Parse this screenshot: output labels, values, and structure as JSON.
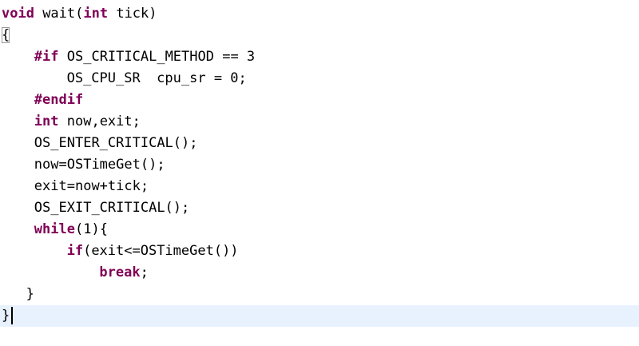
{
  "editor": {
    "colors": {
      "keyword": "#7f0055",
      "text": "#000000",
      "current_line": "#e8f2fe",
      "background": "#ffffff"
    },
    "lines": [
      {
        "indent": 0,
        "tokens": [
          {
            "t": "void",
            "k": "kw"
          },
          {
            "t": " wait(",
            "k": "plain"
          },
          {
            "t": "int",
            "k": "kw"
          },
          {
            "t": " tick)",
            "k": "plain"
          }
        ]
      },
      {
        "indent": 0,
        "tokens": [
          {
            "t": "{",
            "k": "plain",
            "hl": true
          }
        ]
      },
      {
        "indent": 4,
        "tokens": [
          {
            "t": "#if",
            "k": "kw"
          },
          {
            "t": " OS_CRITICAL_METHOD == 3",
            "k": "plain"
          }
        ]
      },
      {
        "indent": 8,
        "tokens": [
          {
            "t": "OS_CPU_SR  cpu_sr = 0;",
            "k": "plain"
          }
        ]
      },
      {
        "indent": 4,
        "tokens": [
          {
            "t": "#endif",
            "k": "kw"
          }
        ]
      },
      {
        "indent": 4,
        "tokens": [
          {
            "t": "int",
            "k": "kw"
          },
          {
            "t": " now,exit;",
            "k": "plain"
          }
        ]
      },
      {
        "indent": 4,
        "tokens": [
          {
            "t": "OS_ENTER_CRITICAL();",
            "k": "plain"
          }
        ]
      },
      {
        "indent": 4,
        "tokens": [
          {
            "t": "now=OSTimeGet();",
            "k": "plain"
          }
        ]
      },
      {
        "indent": 4,
        "tokens": [
          {
            "t": "exit=now+tick;",
            "k": "plain"
          }
        ]
      },
      {
        "indent": 4,
        "tokens": [
          {
            "t": "OS_EXIT_CRITICAL();",
            "k": "plain"
          }
        ]
      },
      {
        "indent": 4,
        "tokens": [
          {
            "t": "while",
            "k": "kw"
          },
          {
            "t": "(1){",
            "k": "plain"
          }
        ]
      },
      {
        "indent": 8,
        "tokens": [
          {
            "t": "if",
            "k": "kw"
          },
          {
            "t": "(exit<=OSTimeGet())",
            "k": "plain"
          }
        ]
      },
      {
        "indent": 12,
        "tokens": [
          {
            "t": "break",
            "k": "kw"
          },
          {
            "t": ";",
            "k": "plain"
          }
        ]
      },
      {
        "indent": 3,
        "tokens": [
          {
            "t": "}",
            "k": "plain"
          }
        ]
      },
      {
        "indent": 0,
        "current": true,
        "caret_after": true,
        "tokens": [
          {
            "t": "}",
            "k": "plain"
          }
        ]
      }
    ]
  }
}
